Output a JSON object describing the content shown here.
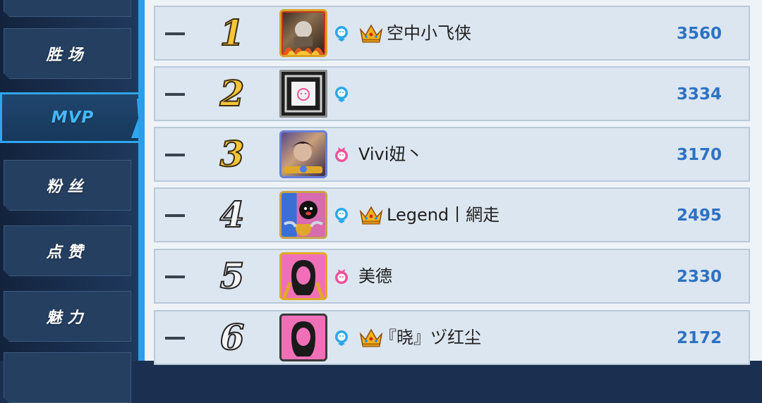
{
  "sidebar": {
    "tabs": [
      {
        "label": "胜场",
        "active": false
      },
      {
        "label": "MVP",
        "active": true
      },
      {
        "label": "粉丝",
        "active": false
      },
      {
        "label": "点赞",
        "active": false
      },
      {
        "label": "魅力",
        "active": false
      }
    ]
  },
  "colors": {
    "accent": "#2ea6f0",
    "score": "#2d72c4",
    "rank_gold": "#f7c536",
    "male_icon": "#2aa8e8",
    "female_icon": "#f0529b"
  },
  "rankings": [
    {
      "rank": "1",
      "trend": "—",
      "gender": "male-icon",
      "crown": true,
      "name": "空中小飞侠",
      "score": "3560"
    },
    {
      "rank": "2",
      "trend": "—",
      "gender": "male-icon",
      "crown": false,
      "name": "",
      "score": "3334"
    },
    {
      "rank": "3",
      "trend": "—",
      "gender": "female-icon",
      "crown": false,
      "name": "Vivi妞丶",
      "score": "3170"
    },
    {
      "rank": "4",
      "trend": "—",
      "gender": "male-icon",
      "crown": true,
      "name": "Legend丨網走",
      "score": "2495"
    },
    {
      "rank": "5",
      "trend": "—",
      "gender": "female-icon",
      "crown": false,
      "name": "美德",
      "score": "2330"
    },
    {
      "rank": "6",
      "trend": "—",
      "gender": "male-icon",
      "crown": true,
      "name": "『晓』ヅ红尘",
      "score": "2172"
    }
  ]
}
